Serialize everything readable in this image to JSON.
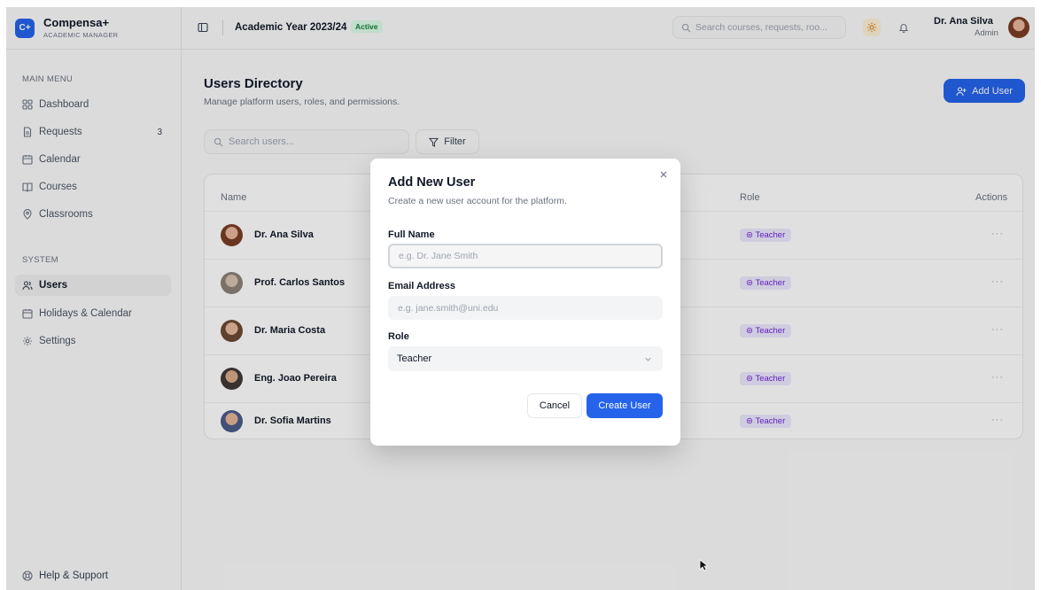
{
  "brand": {
    "logo_text": "C+",
    "name": "Compensa+",
    "subtitle": "ACADEMIC MANAGER"
  },
  "sidebar": {
    "main_menu_label": "MAIN MENU",
    "main_items": [
      {
        "label": "Dashboard",
        "icon": "grid-icon"
      },
      {
        "label": "Requests",
        "icon": "document-icon",
        "badge": "3"
      },
      {
        "label": "Calendar",
        "icon": "calendar-icon"
      },
      {
        "label": "Courses",
        "icon": "book-icon"
      },
      {
        "label": "Classrooms",
        "icon": "map-pin-icon"
      }
    ],
    "system_label": "SYSTEM",
    "system_items": [
      {
        "label": "Users",
        "icon": "users-icon",
        "active": true
      },
      {
        "label": "Holidays & Calendar",
        "icon": "calendar-icon"
      },
      {
        "label": "Settings",
        "icon": "gear-icon"
      }
    ],
    "help_label": "Help & Support"
  },
  "topbar": {
    "academic_year": "Academic Year 2023/24",
    "status_badge": "Active",
    "search_placeholder": "Search courses, requests, roo...",
    "user_name": "Dr. Ana Silva",
    "user_role": "Admin"
  },
  "main": {
    "title": "Users Directory",
    "subtitle": "Manage platform users, roles, and permissions.",
    "add_user_label": "Add User",
    "search_placeholder": "Search users...",
    "filter_label": "Filter",
    "table": {
      "headers": {
        "name": "Name",
        "role": "Role",
        "actions": "Actions"
      },
      "rows": [
        {
          "name": "Dr. Ana Silva",
          "role": "Teacher",
          "actions": "···"
        },
        {
          "name": "Prof. Carlos Santos",
          "role": "Teacher",
          "actions": "···"
        },
        {
          "name": "Dr. Maria Costa",
          "role": "Teacher",
          "actions": "···"
        },
        {
          "name": "Eng. Joao Pereira",
          "role": "Teacher",
          "actions": "···"
        },
        {
          "name": "Dr. Sofia Martins",
          "role": "Teacher",
          "actions": "···"
        }
      ]
    }
  },
  "modal": {
    "title": "Add New User",
    "subtitle": "Create a new user account for the platform.",
    "full_name_label": "Full Name",
    "full_name_placeholder": "e.g. Dr. Jane Smith",
    "full_name_value": "",
    "email_label": "Email Address",
    "email_placeholder": "e.g. jane.smith@uni.edu",
    "email_value": "",
    "role_label": "Role",
    "role_value": "Teacher",
    "cancel_label": "Cancel",
    "create_label": "Create User"
  },
  "colors": {
    "accent": "#2563eb",
    "active_green": "#15803d",
    "role_purple": "#6d28d9"
  }
}
